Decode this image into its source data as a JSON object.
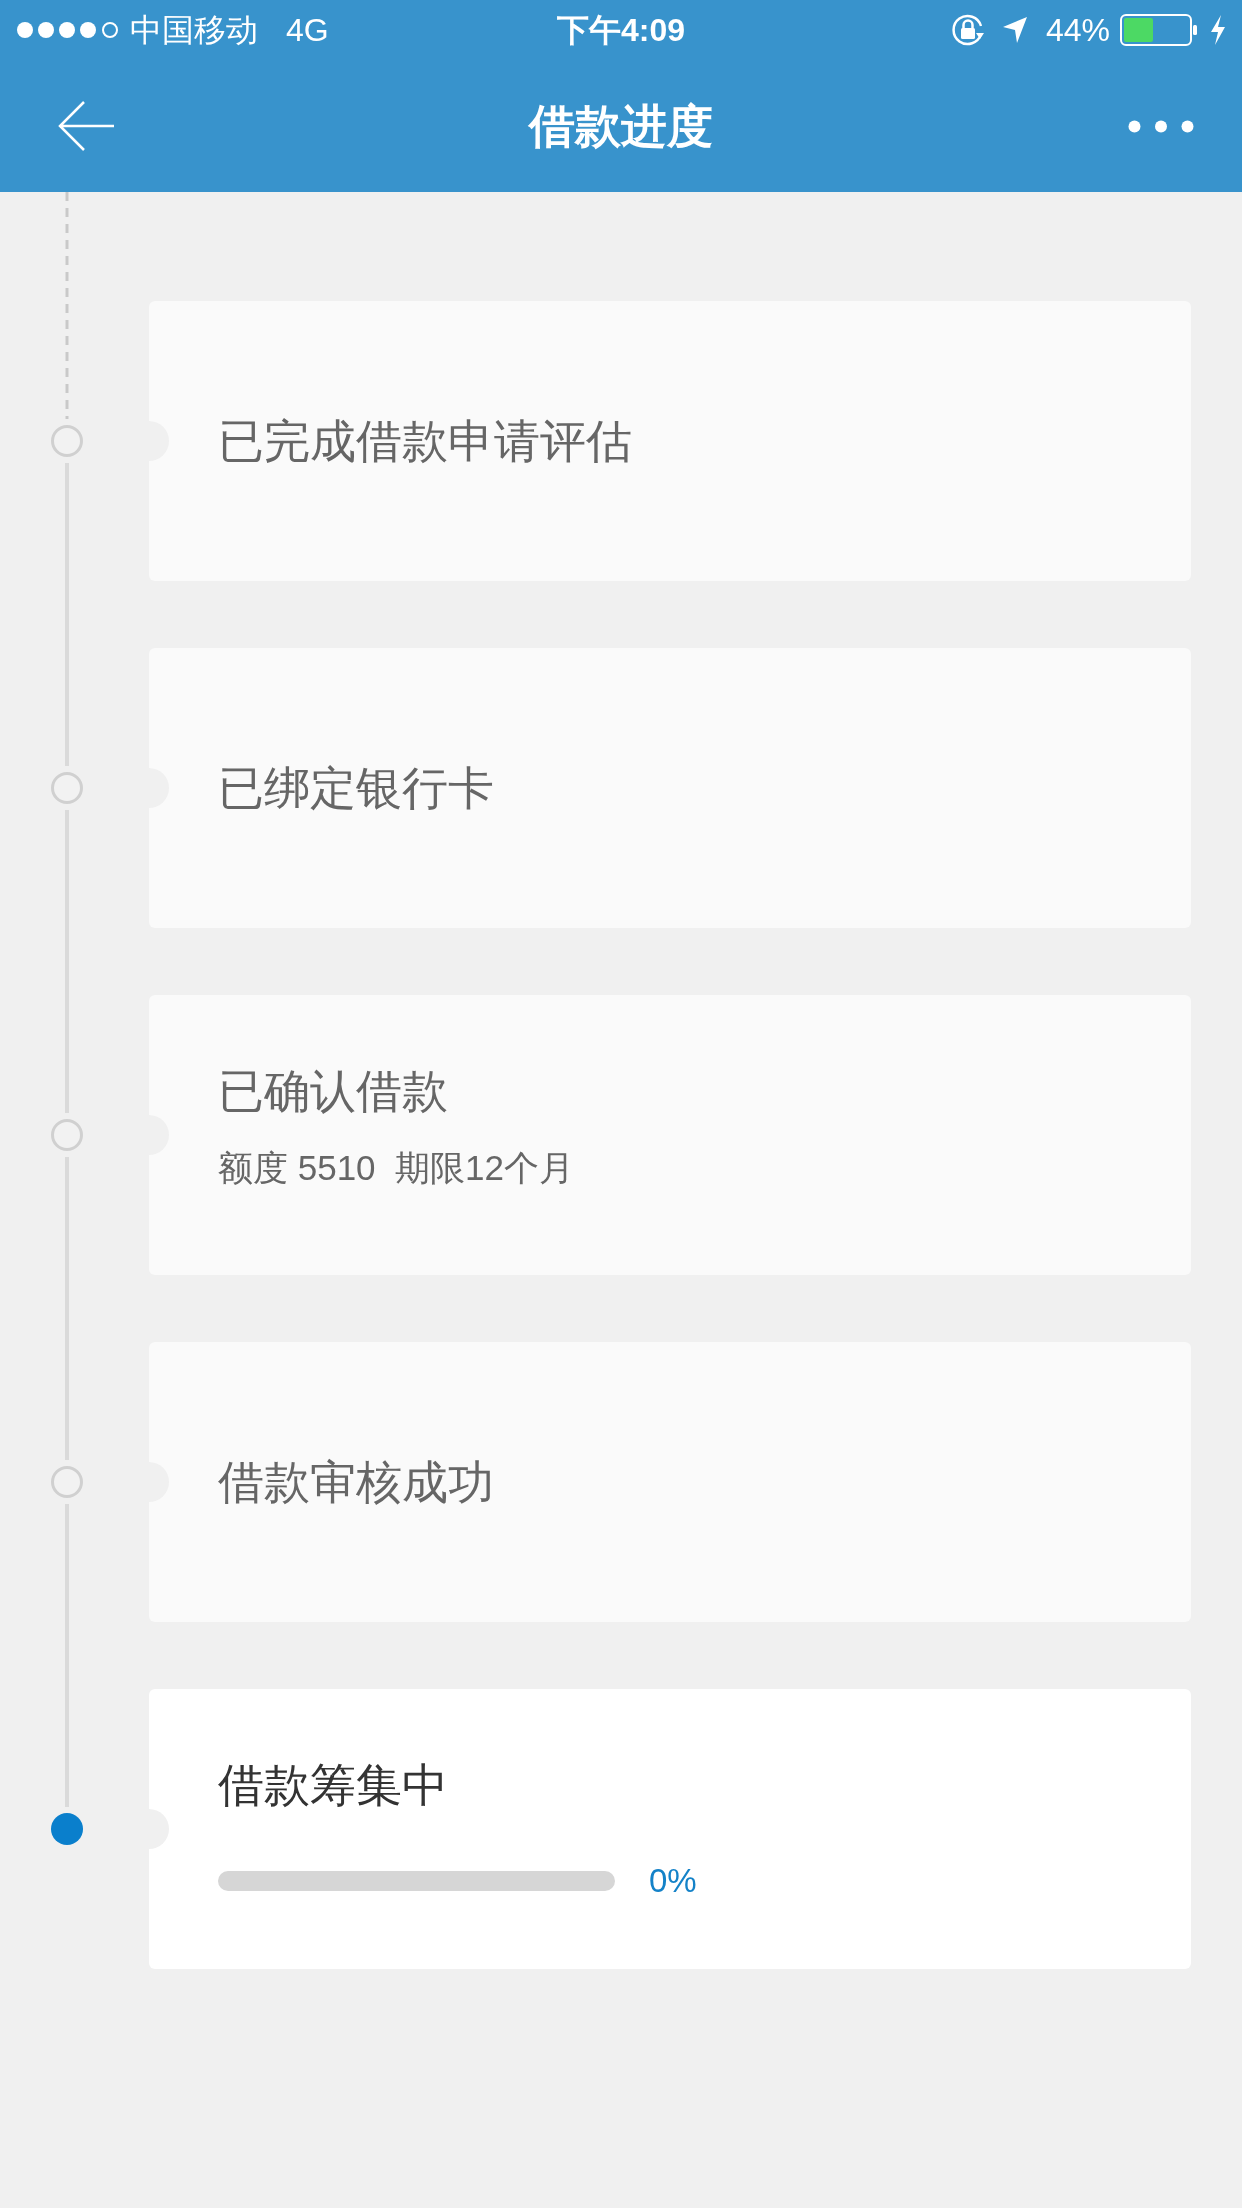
{
  "status_bar": {
    "carrier": "中国移动",
    "network": "4G",
    "time": "下午4:09",
    "battery": "44%"
  },
  "nav_bar": {
    "title": "借款进度"
  },
  "steps": [
    {
      "title": "已完成借款申请评估",
      "current": false
    },
    {
      "title": "已绑定银行卡",
      "current": false
    },
    {
      "title": "已确认借款",
      "detail": "额度 5510  期限12个月",
      "current": false
    },
    {
      "title": "借款审核成功",
      "current": false
    },
    {
      "title": "借款筹集中",
      "current": true,
      "progress": {
        "level": 0,
        "label": "0%"
      }
    }
  ]
}
